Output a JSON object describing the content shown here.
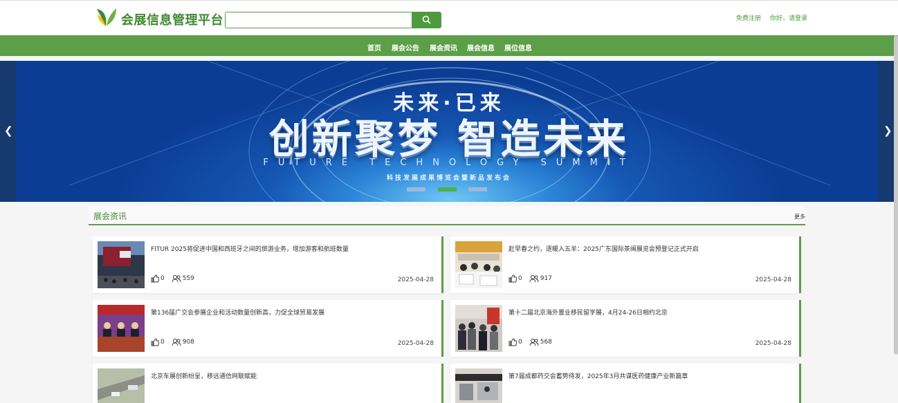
{
  "site": {
    "title": "会展信息管理平台"
  },
  "search": {
    "placeholder": "",
    "button_icon": "search-icon"
  },
  "top_links": {
    "register": "免费注册",
    "login": "你好，请登录"
  },
  "nav": {
    "items": [
      "首页",
      "展会公告",
      "展会资讯",
      "展会信息",
      "展位信息"
    ]
  },
  "banner": {
    "headline": "未来·已来",
    "main": "创新聚梦 智造未来",
    "english": "FUTURE TECHNOLOGY SUMMIT",
    "subtitle": "科技发展成果博览会暨新品发布会",
    "slide_count": 3,
    "active_slide": 2
  },
  "news": {
    "title": "展会资讯",
    "more": "更多",
    "items": [
      {
        "title": "FITUR 2025将促进中国和西班牙之间的旅游业务，增加游客和航班数量",
        "likes": "0",
        "views": "559",
        "date": "2025-04-28"
      },
      {
        "title": "赴早春之约，逐暖入五羊：2025广东国际茶闽展览会预登记正式开启",
        "likes": "0",
        "views": "917",
        "date": "2025-04-28"
      },
      {
        "title": "第136届广交会参展企业和活动数量创新高，力促全球贸易发展",
        "likes": "0",
        "views": "908",
        "date": "2025-04-28"
      },
      {
        "title": "第十二届北京海外置业移民留学展，4月24-26日相约北京",
        "likes": "0",
        "views": "568",
        "date": "2025-04-28"
      },
      {
        "title": "北京车展创新纷呈，移远通信网联赋能",
        "likes": "",
        "views": "",
        "date": ""
      },
      {
        "title": "第7届成都药交会蓄势待发，2025年3月共谋医药健康产业新篇章",
        "likes": "",
        "views": "",
        "date": ""
      }
    ]
  },
  "colors": {
    "brand_green": "#5c9f48",
    "title_green": "#3d8b2f",
    "active_dot": "#4fb04a"
  }
}
